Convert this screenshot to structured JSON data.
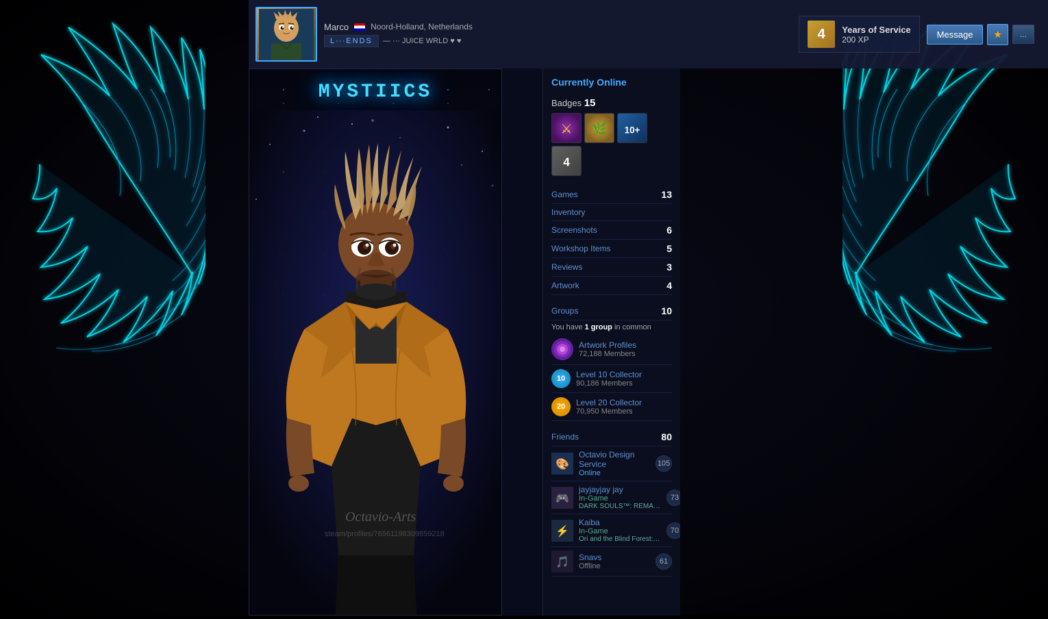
{
  "background": {
    "color": "#000011"
  },
  "topbar": {
    "username": "Marco",
    "location": "Noord-Holland, Netherlands",
    "game_tag": "L∙∙∙ENDS",
    "message_btn": "Message",
    "more_btn": "...",
    "years_label": "Years of Service",
    "years_xp": "200 XP",
    "years_count": "4"
  },
  "showcase": {
    "title": "MYSTIICS",
    "watermark": "Octavio-Arts",
    "credit": "steam/profiles/76561198309859218"
  },
  "profile": {
    "status": "Currently Online",
    "badges": {
      "label": "Badges",
      "count": "15",
      "items": [
        {
          "type": "purple",
          "icon": "★"
        },
        {
          "type": "gold",
          "icon": "🌿"
        },
        {
          "type": "blue",
          "label": "10+"
        },
        {
          "type": "gray",
          "label": "4"
        }
      ]
    },
    "games": {
      "label": "Games",
      "count": "13"
    },
    "inventory": {
      "label": "Inventory",
      "count": ""
    },
    "screenshots": {
      "label": "Screenshots",
      "count": "6"
    },
    "workshop": {
      "label": "Workshop Items",
      "count": "5"
    },
    "reviews": {
      "label": "Reviews",
      "count": "3"
    },
    "artwork": {
      "label": "Artwork",
      "count": "4"
    },
    "groups": {
      "label": "Groups",
      "count": "10",
      "common_text": "You have",
      "common_count": "1 group",
      "common_suffix": "in common",
      "items": [
        {
          "name": "Artwork Profiles",
          "members": "72,188 Members",
          "type": "purple"
        }
      ],
      "collector_groups": [
        {
          "level": "10",
          "name": "Level 10 Collector",
          "members": "90,186 Members",
          "type": "teal"
        },
        {
          "level": "20",
          "name": "Level 20 Collector",
          "members": "70,950 Members",
          "type": "gold"
        }
      ]
    },
    "friends": {
      "label": "Friends",
      "count": "80",
      "items": [
        {
          "name": "Octavio Design Service",
          "status": "Online",
          "status_type": "online",
          "game": "",
          "mutual": "105",
          "icon": "🎨"
        },
        {
          "name": "jayjayjay jay",
          "status": "In-Game",
          "status_type": "in-game",
          "game": "DARK SOULS™: REMASTERED",
          "mutual": "73",
          "icon": "🎮"
        },
        {
          "name": "Kaiba",
          "status": "In-Game",
          "status_type": "in-game",
          "game": "Ori and the Blind Forest: Definitive...",
          "mutual": "70",
          "icon": "⚡"
        },
        {
          "name": "Snavs",
          "status": "Offline",
          "status_type": "offline",
          "game": "",
          "mutual": "61",
          "icon": "🎵"
        }
      ]
    }
  }
}
